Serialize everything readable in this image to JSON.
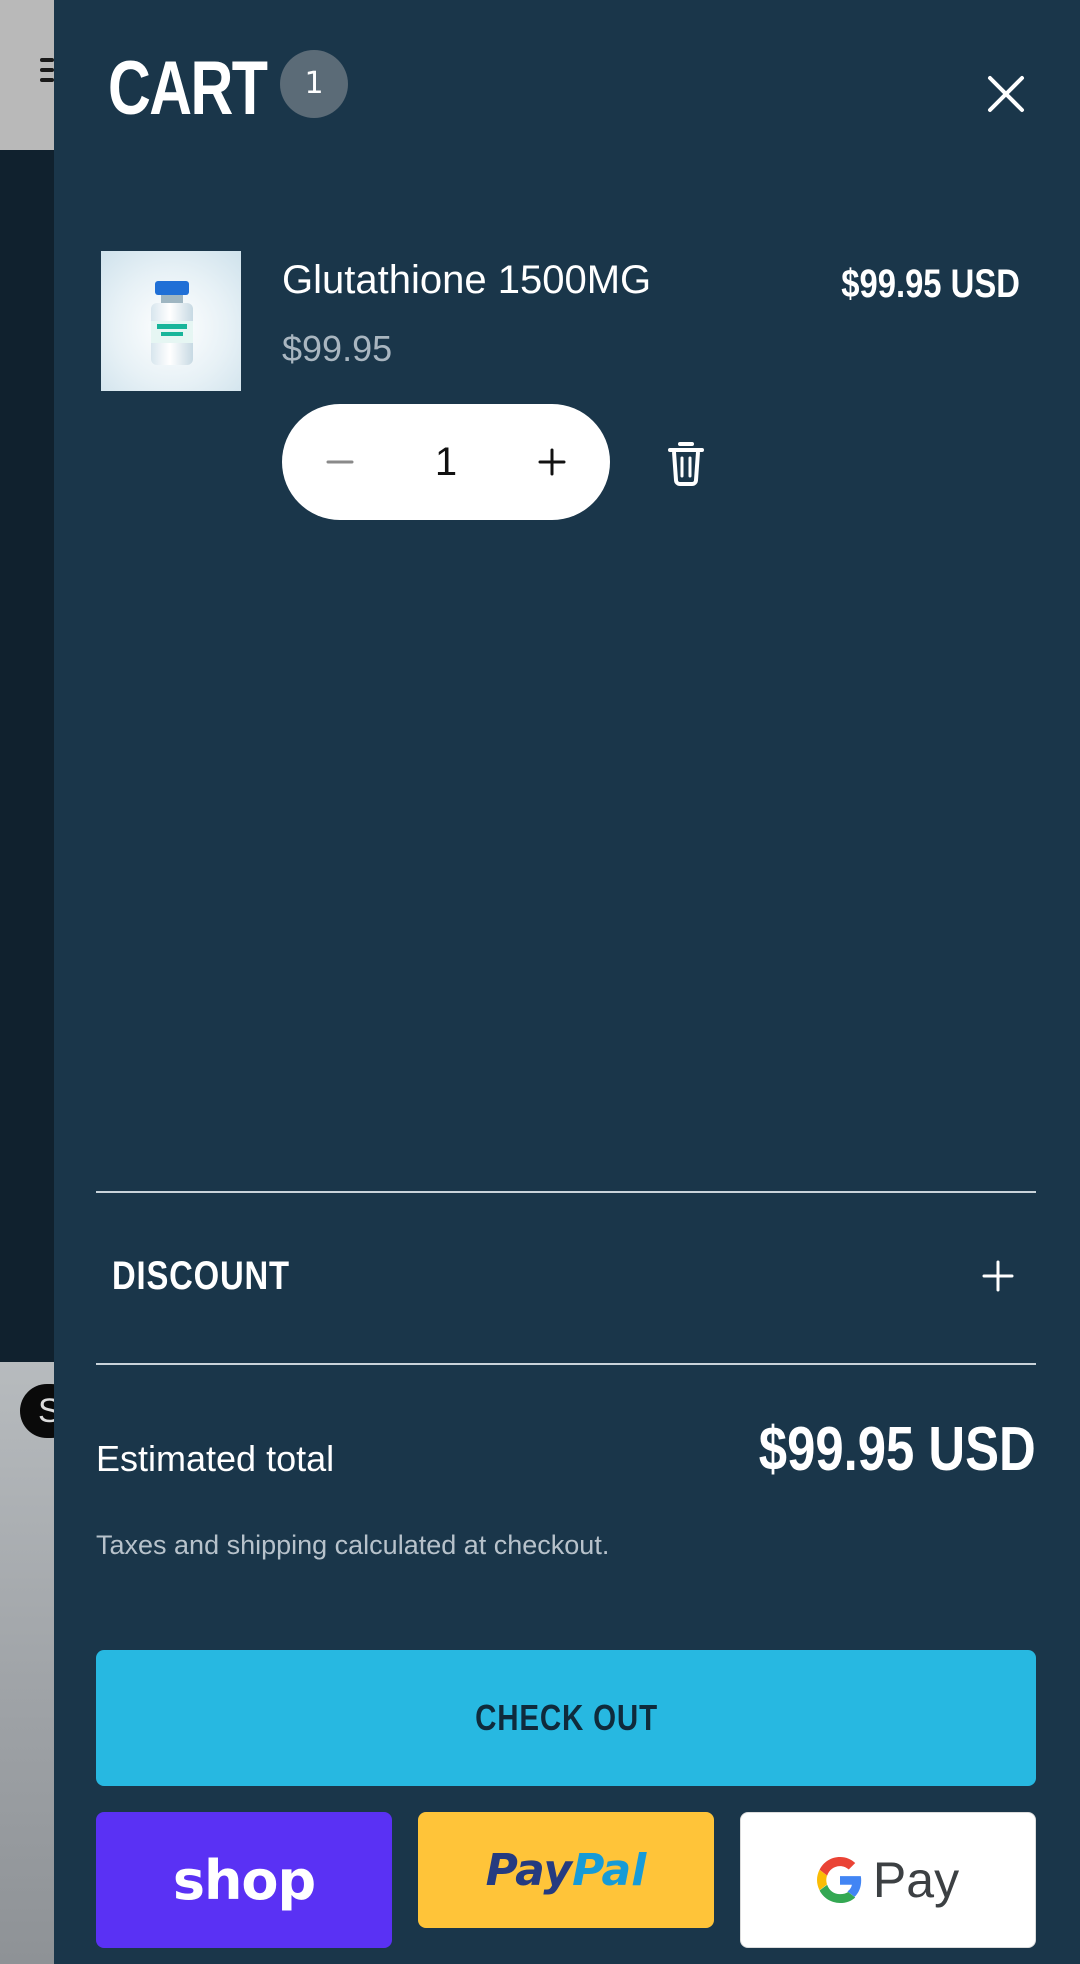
{
  "background": {
    "chip_letter": "S"
  },
  "cart": {
    "title": "CART",
    "count": "1",
    "close_icon": "close-icon"
  },
  "item": {
    "name": "Glutathione 1500MG",
    "unit_price": "$99.95",
    "line_total": "$99.95 USD",
    "quantity": "1",
    "decrease_icon": "minus-icon",
    "increase_icon": "plus-icon",
    "remove_icon": "trash-icon"
  },
  "discount": {
    "label": "DISCOUNT",
    "toggle_icon": "plus-icon"
  },
  "summary": {
    "estimated_label": "Estimated total",
    "estimated_value": "$99.95 USD",
    "tax_note": "Taxes and shipping calculated at checkout."
  },
  "actions": {
    "checkout_label": "CHECK OUT",
    "shop_pay_label": "shop",
    "paypal_label_a": "Pay",
    "paypal_label_b": "Pal",
    "gpay_label": "Pay"
  },
  "colors": {
    "drawer_bg": "#1a364a",
    "checkout_bg": "#27b8e1",
    "shop_pay_bg": "#5a31f4",
    "paypal_bg": "#ffc439",
    "badge_bg": "#5b6b77"
  }
}
